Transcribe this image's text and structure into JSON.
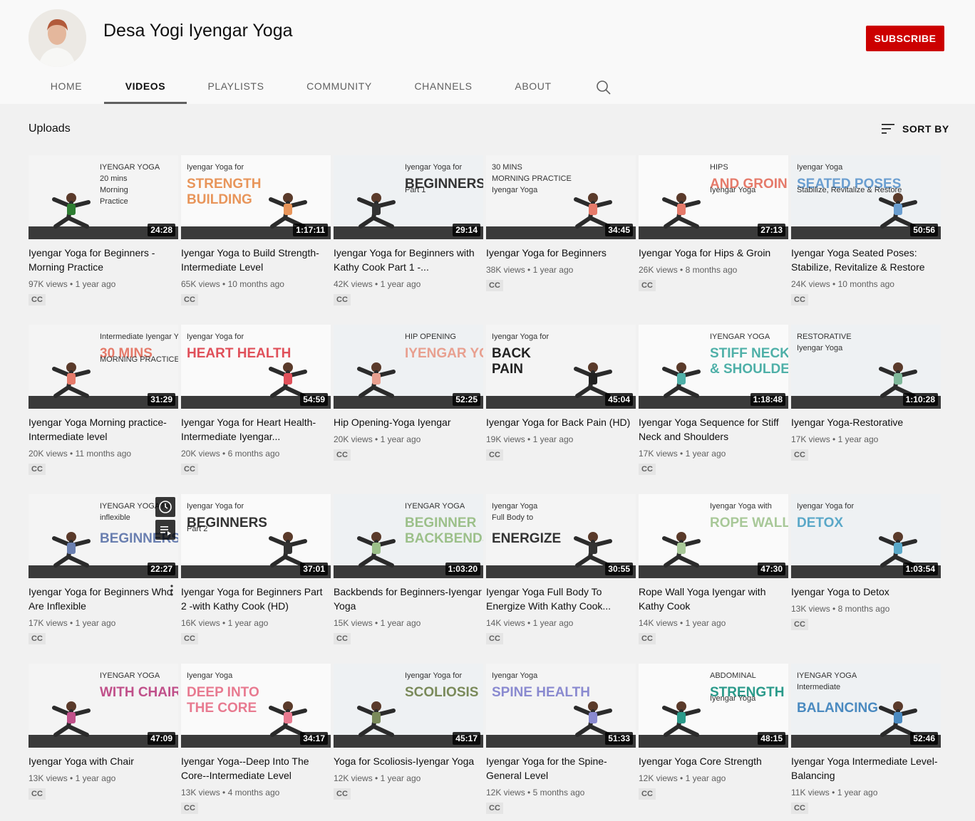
{
  "channel": {
    "name": "Desa Yogi Iyengar Yoga",
    "subscribe_label": "SUBSCRIBE"
  },
  "tabs": [
    "HOME",
    "VIDEOS",
    "PLAYLISTS",
    "COMMUNITY",
    "CHANNELS",
    "ABOUT"
  ],
  "section": {
    "title": "Uploads",
    "sort_label": "SORT BY"
  },
  "cc_label": "CC",
  "videos": [
    {
      "thumb_lines": [
        "IYENGAR YOGA",
        "20 mins",
        "Morning",
        "Practice"
      ],
      "accent": "#2e7d32",
      "duration": "24:28",
      "title": "Iyengar Yoga for Beginners - Morning Practice",
      "views": "97K views",
      "age": "1 year ago"
    },
    {
      "thumb_lines": [
        "Iyengar Yoga for",
        "STRENGTH",
        "BUILDING"
      ],
      "accent": "#e8955a",
      "duration": "1:17:11",
      "title": "Iyengar Yoga to Build Strength-Intermediate Level",
      "views": "65K views",
      "age": "10 months ago"
    },
    {
      "thumb_lines": [
        "Iyengar Yoga for",
        "BEGINNERS",
        "Part 1"
      ],
      "accent": "#333333",
      "duration": "29:14",
      "title": "Iyengar Yoga for Beginners with Kathy Cook Part 1 -...",
      "views": "42K views",
      "age": "1 year ago"
    },
    {
      "thumb_lines": [
        "30 MINS",
        "MORNING PRACTICE",
        "Iyengar Yoga"
      ],
      "accent": "#e57a6a",
      "duration": "34:45",
      "title": "Iyengar Yoga for Beginners",
      "views": "38K views",
      "age": "1 year ago"
    },
    {
      "thumb_lines": [
        "HIPS",
        "AND GROIN",
        "Iyengar Yoga"
      ],
      "accent": "#e57a6a",
      "duration": "27:13",
      "title": "Iyengar Yoga for Hips & Groin",
      "views": "26K views",
      "age": "8 months ago"
    },
    {
      "thumb_lines": [
        "Iyengar Yoga",
        "SEATED POSES",
        "Stabilize, Revitalize & Restore"
      ],
      "accent": "#6a9ed0",
      "duration": "50:56",
      "title": "Iyengar Yoga Seated Poses: Stabilize, Revitalize & Restore",
      "views": "24K views",
      "age": "10 months ago"
    },
    {
      "thumb_lines": [
        "Intermediate Iyengar Yoga",
        "30 MINS",
        "MORNING PRACTICE"
      ],
      "accent": "#e57a6a",
      "duration": "31:29",
      "title": "Iyengar Yoga Morning practice-Intermediate level",
      "views": "20K views",
      "age": "11 months ago"
    },
    {
      "thumb_lines": [
        "Iyengar Yoga for",
        "HEART HEALTH"
      ],
      "accent": "#e0505a",
      "duration": "54:59",
      "title": "Iyengar Yoga for Heart Health-Intermediate Iyengar...",
      "views": "20K views",
      "age": "6 months ago"
    },
    {
      "thumb_lines": [
        "HIP OPENING",
        "IYENGAR YOGA"
      ],
      "accent": "#e8a090",
      "duration": "52:25",
      "title": "Hip Opening-Yoga Iyengar",
      "views": "20K views",
      "age": "1 year ago"
    },
    {
      "thumb_lines": [
        "Iyengar Yoga for",
        "BACK",
        "PAIN"
      ],
      "accent": "#222222",
      "duration": "45:04",
      "title": "Iyengar Yoga for Back Pain (HD)",
      "views": "19K views",
      "age": "1 year ago"
    },
    {
      "thumb_lines": [
        "IYENGAR YOGA",
        "STIFF NECK",
        "& SHOULDERS"
      ],
      "accent": "#4fb0a8",
      "duration": "1:18:48",
      "title": "Iyengar Yoga Sequence for Stiff Neck and Shoulders",
      "views": "17K views",
      "age": "1 year ago"
    },
    {
      "thumb_lines": [
        "RESTORATIVE",
        "Iyengar Yoga"
      ],
      "accent": "#7fb89a",
      "duration": "1:10:28",
      "title": "Iyengar Yoga-Restorative",
      "views": "17K views",
      "age": "1 year ago"
    },
    {
      "thumb_lines": [
        "IYENGAR YOGA for",
        "inflexible",
        "BEGINNERS"
      ],
      "accent": "#6a7fb0",
      "duration": "22:27",
      "title": "Iyengar Yoga for Beginners Who Are Inflexible",
      "views": "17K views",
      "age": "1 year ago"
    },
    {
      "thumb_lines": [
        "Iyengar Yoga for",
        "BEGINNERS",
        "Part 2"
      ],
      "accent": "#333333",
      "duration": "37:01",
      "title": "Iyengar Yoga for Beginners Part 2 -with Kathy Cook (HD)",
      "views": "16K views",
      "age": "1 year ago"
    },
    {
      "thumb_lines": [
        "IYENGAR YOGA",
        "BEGINNER",
        "BACKBENDS"
      ],
      "accent": "#9cc08a",
      "duration": "1:03:20",
      "title": "Backbends for Beginners-Iyengar Yoga",
      "views": "15K views",
      "age": "1 year ago"
    },
    {
      "thumb_lines": [
        "Iyengar Yoga",
        "Full Body to",
        "ENERGIZE"
      ],
      "accent": "#333333",
      "duration": "30:55",
      "title": "Iyengar Yoga Full Body To Energize With Kathy Cook...",
      "views": "14K views",
      "age": "1 year ago"
    },
    {
      "thumb_lines": [
        "Iyengar Yoga with",
        "ROPE WALL"
      ],
      "accent": "#a8c898",
      "duration": "47:30",
      "title": "Rope Wall Yoga Iyengar with Kathy Cook",
      "views": "14K views",
      "age": "1 year ago"
    },
    {
      "thumb_lines": [
        "Iyengar Yoga for",
        "DETOX"
      ],
      "accent": "#5aa8c8",
      "duration": "1:03:54",
      "title": "Iyengar Yoga to Detox",
      "views": "13K views",
      "age": "8 months ago"
    },
    {
      "thumb_lines": [
        "IYENGAR YOGA",
        "WITH CHAIR"
      ],
      "accent": "#c0508a",
      "duration": "47:09",
      "title": "Iyengar Yoga with Chair",
      "views": "13K views",
      "age": "1 year ago"
    },
    {
      "thumb_lines": [
        "Iyengar Yoga",
        "DEEP INTO",
        "THE CORE"
      ],
      "accent": "#e87a90",
      "duration": "34:17",
      "title": "Iyengar Yoga--Deep Into The Core--Intermediate Level",
      "views": "13K views",
      "age": "4 months ago"
    },
    {
      "thumb_lines": [
        "Iyengar Yoga for",
        "SCOLIOSIS"
      ],
      "accent": "#7a8a5a",
      "duration": "45:17",
      "title": "Yoga for Scoliosis-Iyengar Yoga",
      "views": "12K views",
      "age": "1 year ago"
    },
    {
      "thumb_lines": [
        "Iyengar Yoga",
        "SPINE HEALTH"
      ],
      "accent": "#8a8ad0",
      "duration": "51:33",
      "title": "Iyengar Yoga for the Spine-General Level",
      "views": "12K views",
      "age": "5 months ago"
    },
    {
      "thumb_lines": [
        "ABDOMINAL",
        "STRENGTH",
        "Iyengar Yoga"
      ],
      "accent": "#2a9a8a",
      "duration": "48:15",
      "title": "Iyengar Yoga Core Strength",
      "views": "12K views",
      "age": "1 year ago"
    },
    {
      "thumb_lines": [
        "IYENGAR YOGA",
        "Intermediate",
        "BALANCING"
      ],
      "accent": "#4a8ac0",
      "duration": "52:46",
      "title": "Iyengar Yoga Intermediate Level-Balancing",
      "views": "11K views",
      "age": "1 year ago"
    }
  ]
}
